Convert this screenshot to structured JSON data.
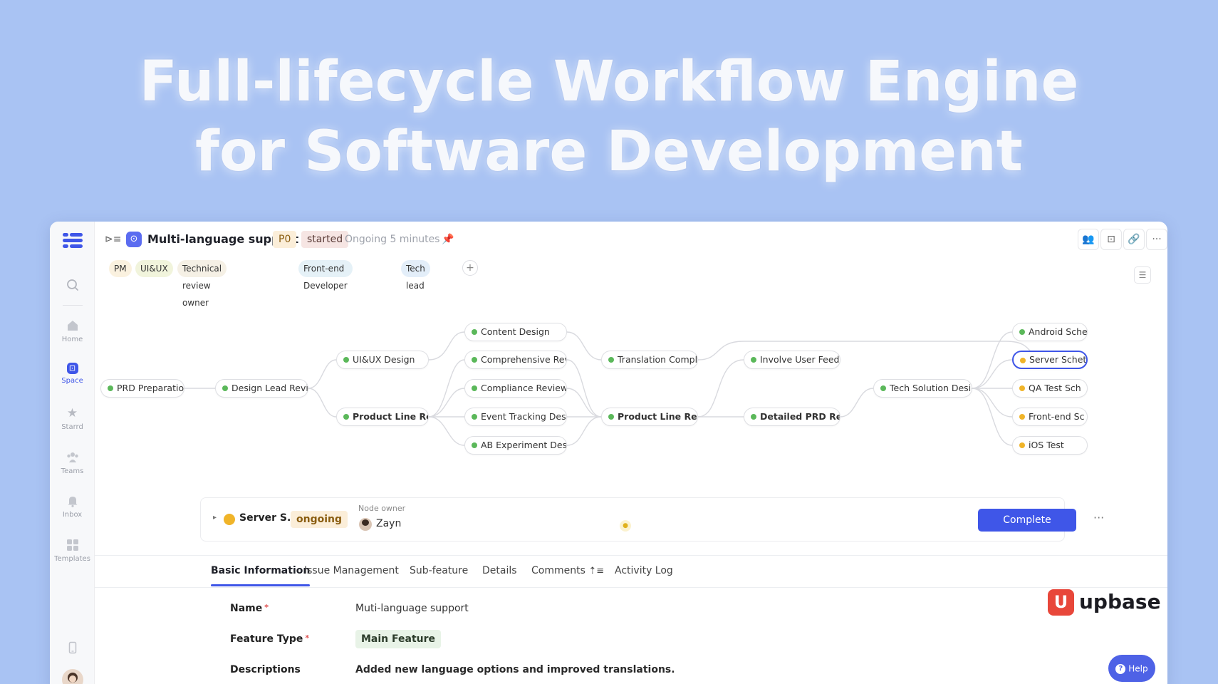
{
  "hero": {
    "line1": "Full-lifecycle Workflow Engine",
    "line2": "for Software Development"
  },
  "sidebar": {
    "items": [
      {
        "name": "search",
        "label": ""
      },
      {
        "name": "home",
        "label": "Home"
      },
      {
        "name": "space",
        "label": "Space"
      },
      {
        "name": "starred",
        "label": "Starrd"
      },
      {
        "name": "teams",
        "label": "Teams"
      },
      {
        "name": "inbox",
        "label": "Inbox"
      },
      {
        "name": "templates",
        "label": "Templates"
      }
    ]
  },
  "header": {
    "title": "Multi-language support",
    "priority": "P0",
    "status": "started",
    "duration": "Ongoing 5 minutes"
  },
  "roles": [
    "PM",
    "UI&UX",
    "Technical review owner",
    "Front-end Developer",
    "Tech lead"
  ],
  "workflow": {
    "nodes": [
      {
        "id": "prd",
        "label": "PRD Preparation",
        "status": "done"
      },
      {
        "id": "dlr",
        "label": "Design Lead Review",
        "status": "done"
      },
      {
        "id": "uiux",
        "label": "UI&UX Design",
        "status": "done"
      },
      {
        "id": "plr1",
        "label": "Product Line Review",
        "status": "done"
      },
      {
        "id": "cd",
        "label": "Content Design",
        "status": "done"
      },
      {
        "id": "cr",
        "label": "Comprehensive Review",
        "status": "done"
      },
      {
        "id": "comp",
        "label": "Compliance Review",
        "status": "done"
      },
      {
        "id": "etd",
        "label": "Event Tracking Design",
        "status": "done"
      },
      {
        "id": "ab",
        "label": "AB Experiment Design",
        "status": "done"
      },
      {
        "id": "tc",
        "label": "Translation Complete",
        "status": "done"
      },
      {
        "id": "plr2",
        "label": "Product Line Review",
        "status": "done"
      },
      {
        "id": "iuf",
        "label": "Involve User Feedback",
        "status": "done"
      },
      {
        "id": "dprd",
        "label": "Detailed PRD Review",
        "status": "done"
      },
      {
        "id": "tsd",
        "label": "Tech Solution Design",
        "status": "done"
      },
      {
        "id": "and",
        "label": "Android Sche",
        "status": "done"
      },
      {
        "id": "srv",
        "label": "Server Schet",
        "status": "ongoing"
      },
      {
        "id": "qa",
        "label": "QA Test Sch",
        "status": "ongoing"
      },
      {
        "id": "fe",
        "label": "Front-end Sc",
        "status": "ongoing"
      },
      {
        "id": "ios",
        "label": "iOS Test",
        "status": "ongoing"
      }
    ]
  },
  "current_node": {
    "name": "Server S...",
    "status": "ongoing",
    "owner_label": "Node owner",
    "owner": "Zayn",
    "complete_label": "Complete"
  },
  "tabs": [
    "Basic Information",
    "Issue Management",
    "Sub-feature",
    "Details",
    "Comments",
    "Activity Log"
  ],
  "form": {
    "name_label": "Name",
    "name_value": "Muti-language support",
    "type_label": "Feature Type",
    "type_value": "Main Feature",
    "desc_label": "Descriptions",
    "desc_value": "Added new language options and improved translations."
  },
  "brand": {
    "name": "upbase",
    "help": "Help"
  },
  "colors": {
    "accent": "#3f56e8",
    "done": "#5bb85a",
    "ongoing": "#f0b429",
    "brand_red": "#e8473a"
  }
}
